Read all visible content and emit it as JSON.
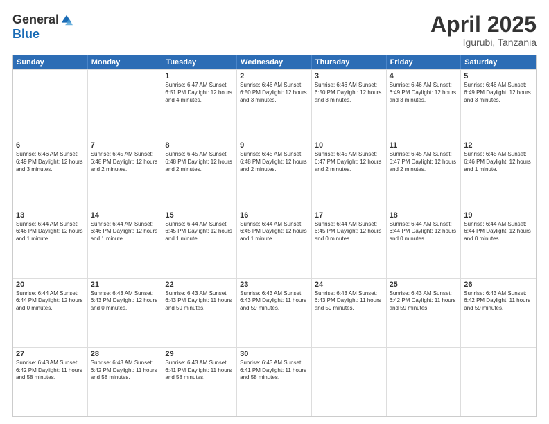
{
  "logo": {
    "general": "General",
    "blue": "Blue"
  },
  "title": "April 2025",
  "location": "Igurubi, Tanzania",
  "days": [
    "Sunday",
    "Monday",
    "Tuesday",
    "Wednesday",
    "Thursday",
    "Friday",
    "Saturday"
  ],
  "weeks": [
    [
      {
        "day": "",
        "info": ""
      },
      {
        "day": "",
        "info": ""
      },
      {
        "day": "1",
        "info": "Sunrise: 6:47 AM\nSunset: 6:51 PM\nDaylight: 12 hours and 4 minutes."
      },
      {
        "day": "2",
        "info": "Sunrise: 6:46 AM\nSunset: 6:50 PM\nDaylight: 12 hours and 3 minutes."
      },
      {
        "day": "3",
        "info": "Sunrise: 6:46 AM\nSunset: 6:50 PM\nDaylight: 12 hours and 3 minutes."
      },
      {
        "day": "4",
        "info": "Sunrise: 6:46 AM\nSunset: 6:49 PM\nDaylight: 12 hours and 3 minutes."
      },
      {
        "day": "5",
        "info": "Sunrise: 6:46 AM\nSunset: 6:49 PM\nDaylight: 12 hours and 3 minutes."
      }
    ],
    [
      {
        "day": "6",
        "info": "Sunrise: 6:46 AM\nSunset: 6:49 PM\nDaylight: 12 hours and 3 minutes."
      },
      {
        "day": "7",
        "info": "Sunrise: 6:45 AM\nSunset: 6:48 PM\nDaylight: 12 hours and 2 minutes."
      },
      {
        "day": "8",
        "info": "Sunrise: 6:45 AM\nSunset: 6:48 PM\nDaylight: 12 hours and 2 minutes."
      },
      {
        "day": "9",
        "info": "Sunrise: 6:45 AM\nSunset: 6:48 PM\nDaylight: 12 hours and 2 minutes."
      },
      {
        "day": "10",
        "info": "Sunrise: 6:45 AM\nSunset: 6:47 PM\nDaylight: 12 hours and 2 minutes."
      },
      {
        "day": "11",
        "info": "Sunrise: 6:45 AM\nSunset: 6:47 PM\nDaylight: 12 hours and 2 minutes."
      },
      {
        "day": "12",
        "info": "Sunrise: 6:45 AM\nSunset: 6:46 PM\nDaylight: 12 hours and 1 minute."
      }
    ],
    [
      {
        "day": "13",
        "info": "Sunrise: 6:44 AM\nSunset: 6:46 PM\nDaylight: 12 hours and 1 minute."
      },
      {
        "day": "14",
        "info": "Sunrise: 6:44 AM\nSunset: 6:46 PM\nDaylight: 12 hours and 1 minute."
      },
      {
        "day": "15",
        "info": "Sunrise: 6:44 AM\nSunset: 6:45 PM\nDaylight: 12 hours and 1 minute."
      },
      {
        "day": "16",
        "info": "Sunrise: 6:44 AM\nSunset: 6:45 PM\nDaylight: 12 hours and 1 minute."
      },
      {
        "day": "17",
        "info": "Sunrise: 6:44 AM\nSunset: 6:45 PM\nDaylight: 12 hours and 0 minutes."
      },
      {
        "day": "18",
        "info": "Sunrise: 6:44 AM\nSunset: 6:44 PM\nDaylight: 12 hours and 0 minutes."
      },
      {
        "day": "19",
        "info": "Sunrise: 6:44 AM\nSunset: 6:44 PM\nDaylight: 12 hours and 0 minutes."
      }
    ],
    [
      {
        "day": "20",
        "info": "Sunrise: 6:44 AM\nSunset: 6:44 PM\nDaylight: 12 hours and 0 minutes."
      },
      {
        "day": "21",
        "info": "Sunrise: 6:43 AM\nSunset: 6:43 PM\nDaylight: 12 hours and 0 minutes."
      },
      {
        "day": "22",
        "info": "Sunrise: 6:43 AM\nSunset: 6:43 PM\nDaylight: 11 hours and 59 minutes."
      },
      {
        "day": "23",
        "info": "Sunrise: 6:43 AM\nSunset: 6:43 PM\nDaylight: 11 hours and 59 minutes."
      },
      {
        "day": "24",
        "info": "Sunrise: 6:43 AM\nSunset: 6:43 PM\nDaylight: 11 hours and 59 minutes."
      },
      {
        "day": "25",
        "info": "Sunrise: 6:43 AM\nSunset: 6:42 PM\nDaylight: 11 hours and 59 minutes."
      },
      {
        "day": "26",
        "info": "Sunrise: 6:43 AM\nSunset: 6:42 PM\nDaylight: 11 hours and 59 minutes."
      }
    ],
    [
      {
        "day": "27",
        "info": "Sunrise: 6:43 AM\nSunset: 6:42 PM\nDaylight: 11 hours and 58 minutes."
      },
      {
        "day": "28",
        "info": "Sunrise: 6:43 AM\nSunset: 6:42 PM\nDaylight: 11 hours and 58 minutes."
      },
      {
        "day": "29",
        "info": "Sunrise: 6:43 AM\nSunset: 6:41 PM\nDaylight: 11 hours and 58 minutes."
      },
      {
        "day": "30",
        "info": "Sunrise: 6:43 AM\nSunset: 6:41 PM\nDaylight: 11 hours and 58 minutes."
      },
      {
        "day": "",
        "info": ""
      },
      {
        "day": "",
        "info": ""
      },
      {
        "day": "",
        "info": ""
      }
    ]
  ]
}
